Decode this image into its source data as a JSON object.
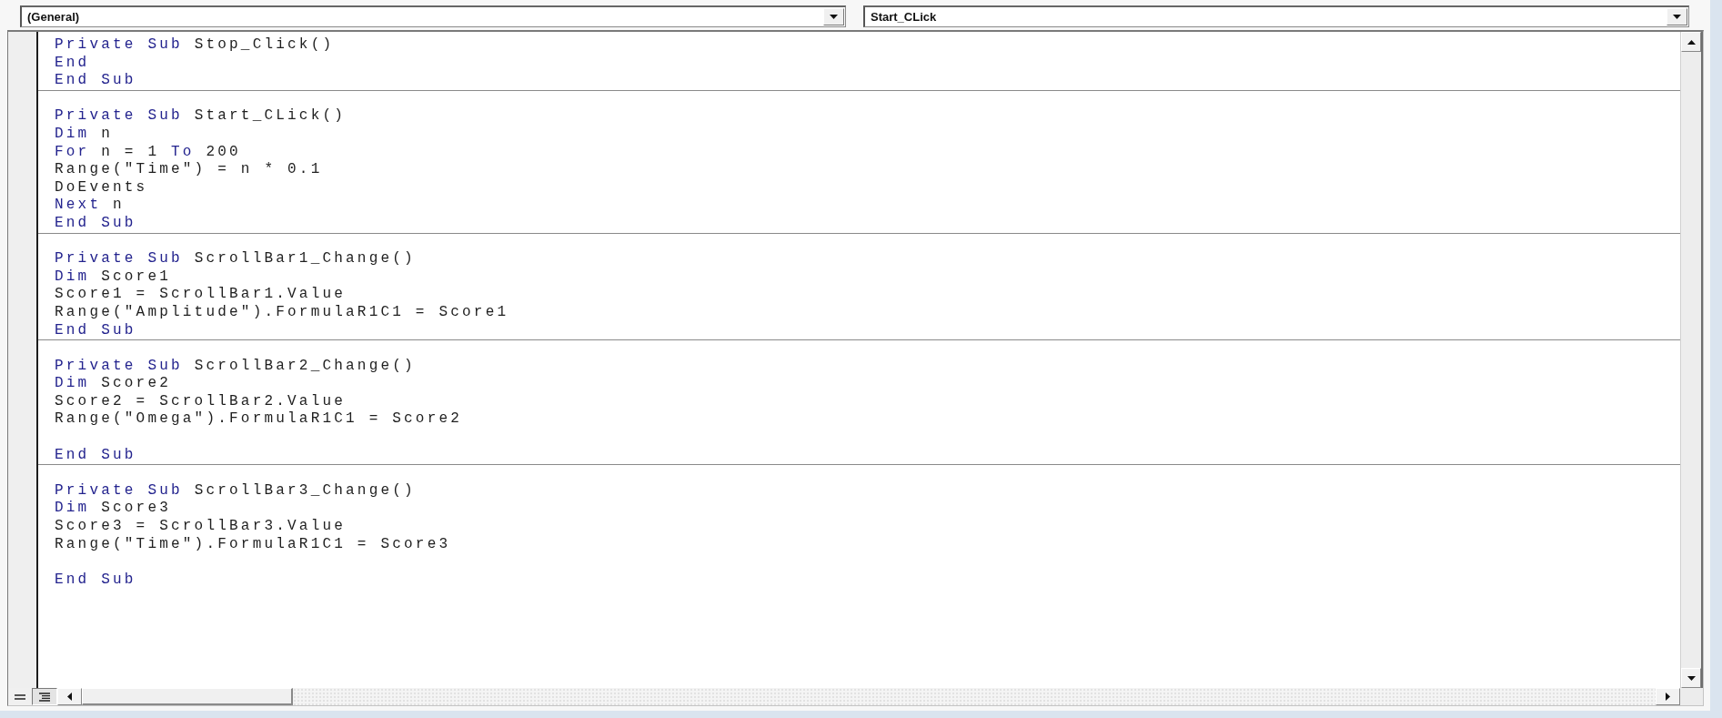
{
  "object_dropdown": {
    "value": "(General)"
  },
  "procedure_dropdown": {
    "value": "Start_CLick"
  },
  "procedures": [
    {
      "lines": [
        {
          "kind": "code",
          "segments": [
            {
              "kind": "keyword",
              "text": "Private Sub"
            },
            {
              "kind": "plain",
              "text": " Stop_Click()"
            }
          ]
        },
        {
          "kind": "code",
          "segments": [
            {
              "kind": "keyword",
              "text": "End"
            }
          ]
        },
        {
          "kind": "code",
          "segments": [
            {
              "kind": "keyword",
              "text": "End Sub"
            }
          ]
        }
      ]
    },
    {
      "lines": [
        {
          "kind": "code",
          "segments": [
            {
              "kind": "keyword",
              "text": "Private Sub"
            },
            {
              "kind": "plain",
              "text": " Start_CLick()"
            }
          ]
        },
        {
          "kind": "code",
          "segments": [
            {
              "kind": "keyword",
              "text": "Dim"
            },
            {
              "kind": "plain",
              "text": " n"
            }
          ]
        },
        {
          "kind": "code",
          "segments": [
            {
              "kind": "keyword",
              "text": "For"
            },
            {
              "kind": "plain",
              "text": " n = 1 "
            },
            {
              "kind": "keyword",
              "text": "To"
            },
            {
              "kind": "plain",
              "text": " 200"
            }
          ]
        },
        {
          "kind": "code",
          "segments": [
            {
              "kind": "plain",
              "text": "Range(\"Time\") = n * 0.1"
            }
          ]
        },
        {
          "kind": "code",
          "segments": [
            {
              "kind": "plain",
              "text": "DoEvents"
            }
          ]
        },
        {
          "kind": "code",
          "segments": [
            {
              "kind": "keyword",
              "text": "Next"
            },
            {
              "kind": "plain",
              "text": " n"
            }
          ]
        },
        {
          "kind": "code",
          "segments": [
            {
              "kind": "keyword",
              "text": "End Sub"
            }
          ]
        }
      ]
    },
    {
      "lines": [
        {
          "kind": "code",
          "segments": [
            {
              "kind": "keyword",
              "text": "Private Sub"
            },
            {
              "kind": "plain",
              "text": " ScrollBar1_Change()"
            }
          ]
        },
        {
          "kind": "code",
          "segments": [
            {
              "kind": "keyword",
              "text": "Dim"
            },
            {
              "kind": "plain",
              "text": " Score1"
            }
          ]
        },
        {
          "kind": "code",
          "segments": [
            {
              "kind": "plain",
              "text": "Score1 = ScrollBar1.Value"
            }
          ]
        },
        {
          "kind": "code",
          "segments": [
            {
              "kind": "plain",
              "text": "Range(\"Amplitude\").FormulaR1C1 = Score1"
            }
          ]
        },
        {
          "kind": "code",
          "segments": [
            {
              "kind": "keyword",
              "text": "End Sub"
            }
          ]
        }
      ]
    },
    {
      "lines": [
        {
          "kind": "code",
          "segments": [
            {
              "kind": "keyword",
              "text": "Private Sub"
            },
            {
              "kind": "plain",
              "text": " ScrollBar2_Change()"
            }
          ]
        },
        {
          "kind": "code",
          "segments": [
            {
              "kind": "keyword",
              "text": "Dim"
            },
            {
              "kind": "plain",
              "text": " Score2"
            }
          ]
        },
        {
          "kind": "code",
          "segments": [
            {
              "kind": "plain",
              "text": "Score2 = ScrollBar2.Value"
            }
          ]
        },
        {
          "kind": "code",
          "segments": [
            {
              "kind": "plain",
              "text": "Range(\"Omega\").FormulaR1C1 = Score2"
            }
          ]
        },
        {
          "kind": "blank"
        },
        {
          "kind": "code",
          "segments": [
            {
              "kind": "keyword",
              "text": "End Sub"
            }
          ]
        }
      ]
    },
    {
      "lines": [
        {
          "kind": "code",
          "segments": [
            {
              "kind": "keyword",
              "text": "Private Sub"
            },
            {
              "kind": "plain",
              "text": " ScrollBar3_Change()"
            }
          ]
        },
        {
          "kind": "code",
          "segments": [
            {
              "kind": "keyword",
              "text": "Dim"
            },
            {
              "kind": "plain",
              "text": " Score3"
            }
          ]
        },
        {
          "kind": "code",
          "segments": [
            {
              "kind": "plain",
              "text": "Score3 = ScrollBar3.Value"
            }
          ]
        },
        {
          "kind": "code",
          "segments": [
            {
              "kind": "plain",
              "text": "Range(\"Time\").FormulaR1C1 = Score3"
            }
          ]
        },
        {
          "kind": "blank"
        },
        {
          "kind": "code",
          "segments": [
            {
              "kind": "keyword",
              "text": "End Sub"
            }
          ]
        }
      ]
    }
  ],
  "view_buttons": [
    {
      "kind": "procedure",
      "selected": false
    },
    {
      "kind": "module",
      "selected": true
    }
  ]
}
